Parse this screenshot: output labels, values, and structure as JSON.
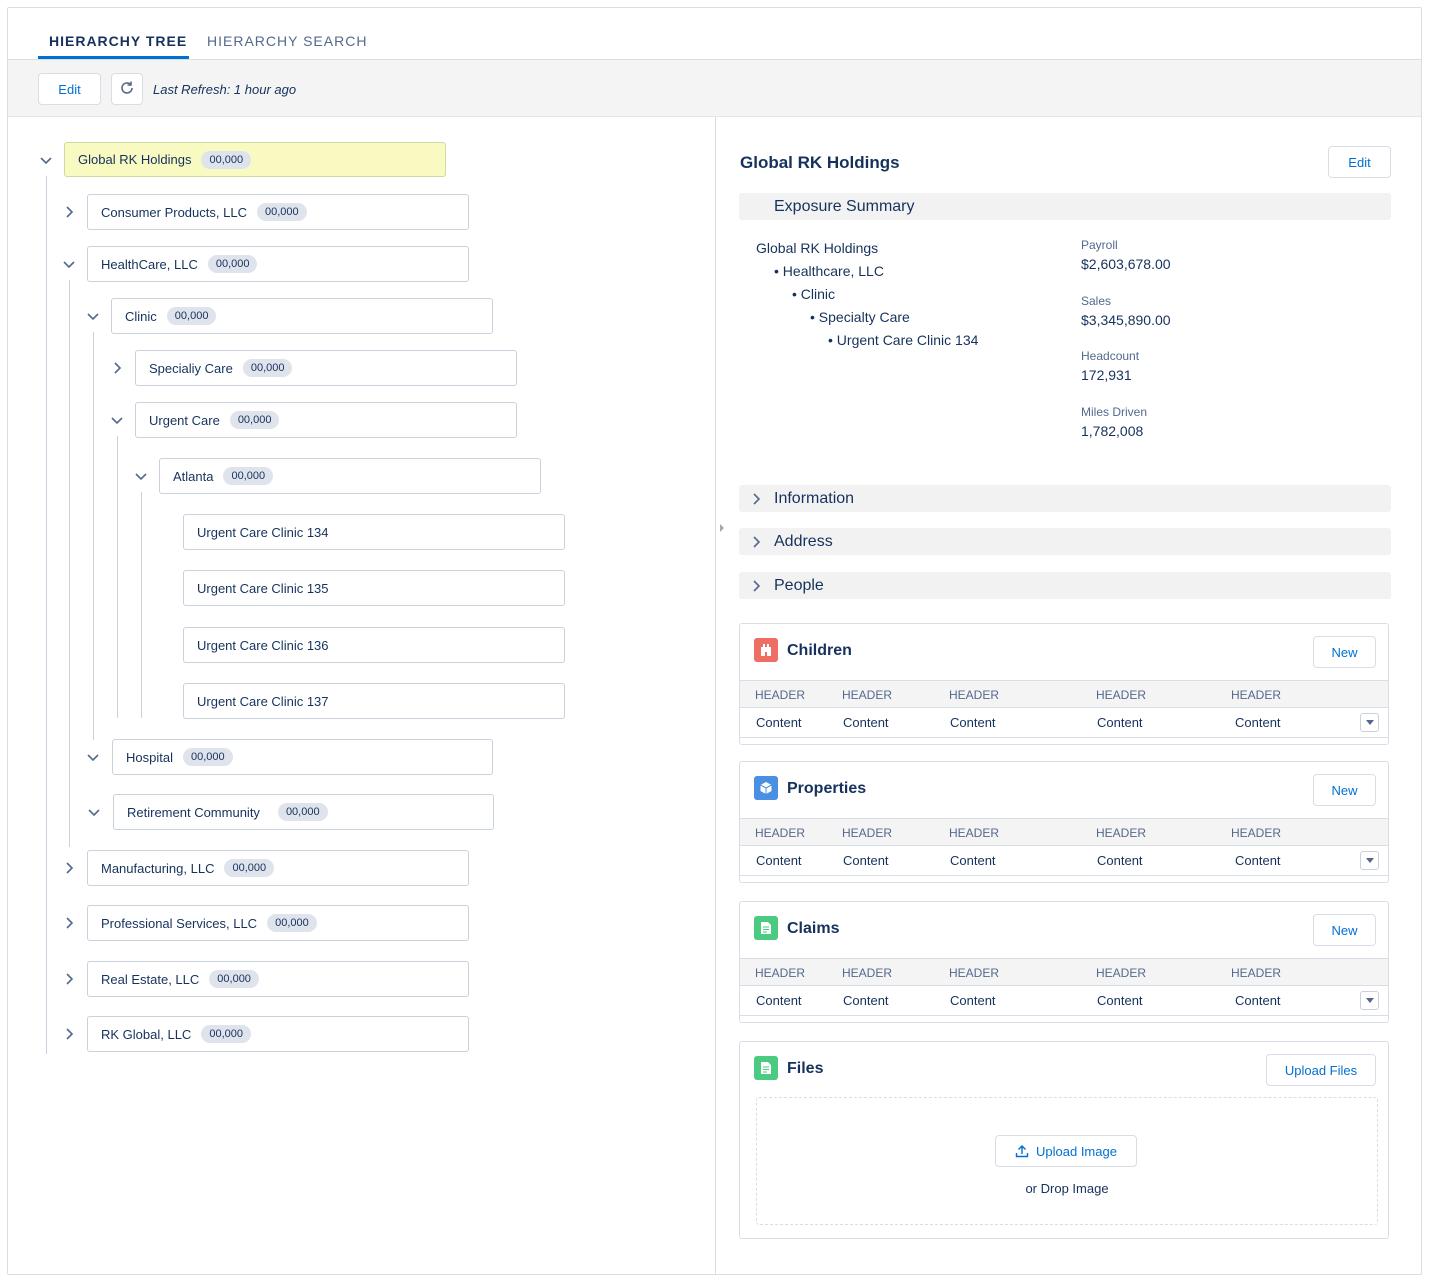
{
  "tabs": [
    {
      "label": "HIERARCHY TREE",
      "active": true
    },
    {
      "label": "HIERARCHY SEARCH",
      "active": false
    }
  ],
  "toolbar": {
    "edit_label": "Edit",
    "refresh_icon": "refresh-icon",
    "last_refresh": "Last Refresh: 1 hour ago"
  },
  "tree": {
    "root": {
      "label": "Global RK Holdings",
      "count": "00,000"
    },
    "consumer": {
      "label": "Consumer Products, LLC",
      "count": "00,000"
    },
    "healthcare": {
      "label": "HealthCare, LLC",
      "count": "00,000"
    },
    "clinic": {
      "label": "Clinic",
      "count": "00,000"
    },
    "specialty": {
      "label": "Specialiy Care",
      "count": "00,000"
    },
    "urgent": {
      "label": "Urgent Care",
      "count": "00,000"
    },
    "atlanta": {
      "label": "Atlanta",
      "count": "00,000"
    },
    "clinics": [
      "Urgent Care Clinic 134",
      "Urgent Care Clinic 135",
      "Urgent Care Clinic 136",
      "Urgent Care Clinic 137"
    ],
    "hospital": {
      "label": "Hospital",
      "count": "00,000"
    },
    "retirement": {
      "label": "Retirement Community",
      "count": "00,000"
    },
    "manufacturing": {
      "label": "Manufacturing, LLC",
      "count": "00,000"
    },
    "professional": {
      "label": "Professional Services, LLC",
      "count": "00,000"
    },
    "realestate": {
      "label": "Real Estate, LLC",
      "count": "00,000"
    },
    "rkglobal": {
      "label": "RK Global, LLC",
      "count": "00,000"
    }
  },
  "detail": {
    "title": "Global RK Holdings",
    "edit_label": "Edit",
    "exposure": {
      "label": "Exposure Summary",
      "path": [
        "Global RK Holdings",
        "• Healthcare, LLC",
        "• Clinic",
        "• Specialty Care",
        "• Urgent Care Clinic 134"
      ],
      "metrics": [
        {
          "label": "Payroll",
          "value": "$2,603,678.00"
        },
        {
          "label": "Sales",
          "value": "$3,345,890.00"
        },
        {
          "label": "Headcount",
          "value": "172,931"
        },
        {
          "label": "Miles Driven",
          "value": "1,782,008"
        }
      ]
    },
    "sections": [
      "Information",
      "Address",
      "People"
    ],
    "cards": [
      {
        "title": "Children",
        "icon": "building-icon",
        "color": "#ef6e64",
        "action": "New",
        "headers": [
          "HEADER",
          "HEADER",
          "HEADER",
          "HEADER",
          "HEADER"
        ],
        "row": [
          "Content",
          "Content",
          "Content",
          "Content",
          "Content"
        ]
      },
      {
        "title": "Properties",
        "icon": "cube-icon",
        "color": "#4a90e2",
        "action": "New",
        "headers": [
          "HEADER",
          "HEADER",
          "HEADER",
          "HEADER",
          "HEADER"
        ],
        "row": [
          "Content",
          "Content",
          "Content",
          "Content",
          "Content"
        ]
      },
      {
        "title": "Claims",
        "icon": "document-icon",
        "color": "#4bca81",
        "action": "New",
        "headers": [
          "HEADER",
          "HEADER",
          "HEADER",
          "HEADER",
          "HEADER"
        ],
        "row": [
          "Content",
          "Content",
          "Content",
          "Content",
          "Content"
        ]
      }
    ],
    "files": {
      "title": "Files",
      "icon": "document-icon",
      "color": "#4bca81",
      "upload_files": "Upload Files",
      "upload_image": "Upload Image",
      "drop_text": "or Drop Image"
    }
  }
}
